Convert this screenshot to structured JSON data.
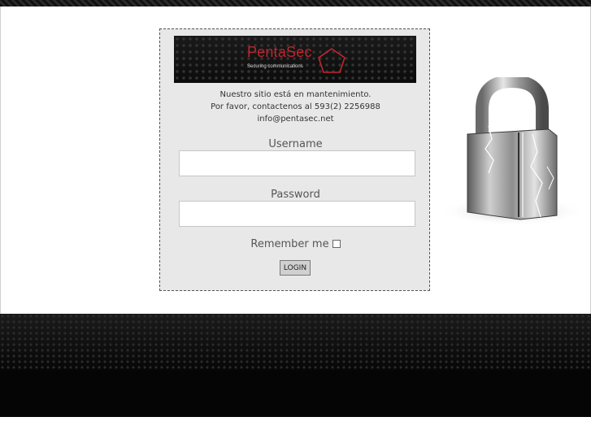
{
  "brand": {
    "name": "PentaSec",
    "tagline": "Securing communications",
    "accent_color": "#c0262c"
  },
  "notice": {
    "line1": "Nuestro sitio está en mantenimiento.",
    "line2": "Por favor, contactenos al 593(2) 2256988",
    "line3": "info@pentasec.net"
  },
  "form": {
    "username_label": "Username",
    "username_value": "",
    "password_label": "Password",
    "password_value": "",
    "remember_label": "Remember me",
    "remember_checked": false,
    "login_label": "LOGIN"
  },
  "decor": {
    "padlock_icon": "padlock-icon",
    "pentagon_icon": "pentagon-icon"
  }
}
